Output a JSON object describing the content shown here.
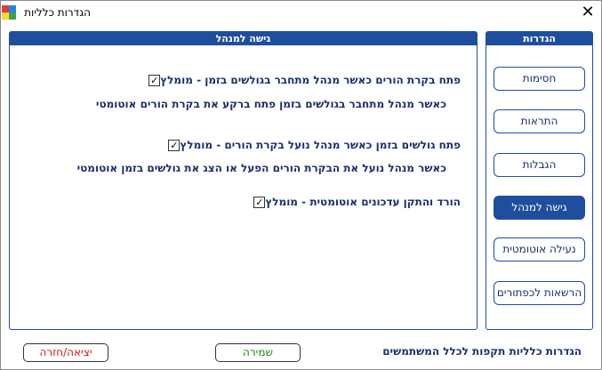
{
  "window": {
    "title": "הגדרות כלליות",
    "close_glyph": "✕"
  },
  "main_panel": {
    "title": "גישה למנהל",
    "options": [
      {
        "label": "פתח בקרת הורים כאשר מנהל מתחבר בגולשים בזמן - מומלץ",
        "checked": true,
        "description": "כאשר מנהל מתחבר בגולשים בזמן פתח ברקע את בקרת הורים אוטומטי"
      },
      {
        "label": "פתח גולשים בזמן כאשר מנהל נועל בקרת הורים  - מומלץ",
        "checked": true,
        "description": "כאשר מנהל נועל את הבקרת הורים הפעל או הצג את גולשים בזמן אוטומטי"
      },
      {
        "label": "הורד והתקן עדכונים אוטומטית - מומלץ",
        "checked": true,
        "description": ""
      }
    ]
  },
  "side_panel": {
    "title": "הגדרות",
    "items": [
      {
        "label": "חסימות",
        "active": false
      },
      {
        "label": "התראות",
        "active": false
      },
      {
        "label": "הגבלות",
        "active": false
      },
      {
        "label": "גישה למנהל",
        "active": true
      },
      {
        "label": "נעילה אוטומטית",
        "active": false
      },
      {
        "label": "הרשאות לכפתורים",
        "active": false
      }
    ]
  },
  "footer": {
    "note": "הגדרות כלליות תקפות לכלל המשתמשים",
    "save_label": "שמירה",
    "exit_label": "יציאה/חזרה",
    "save_color": "#1a8a1a",
    "exit_color": "#d01818"
  },
  "colors": {
    "accent": "#1f4e9e",
    "text": "#1c2f6e"
  }
}
